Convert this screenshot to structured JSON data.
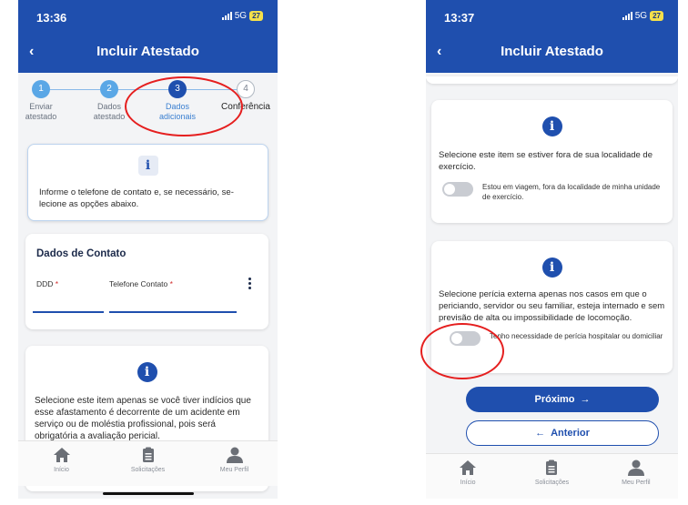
{
  "left": {
    "status": {
      "time": "13:36",
      "network": "5G",
      "battery": "27"
    },
    "header": {
      "back": "‹",
      "title": "Incluir Atestado"
    },
    "steps": [
      {
        "num": "1",
        "label": "Enviar atestado"
      },
      {
        "num": "2",
        "label": "Dados atestado"
      },
      {
        "num": "3",
        "label": "Dados adicionais"
      },
      {
        "num": "4",
        "label": "Conferência"
      }
    ],
    "info_card": {
      "icon": "info-icon",
      "text": "Informe o telefone de contato e, se necessário, se-lecione as opções abaixo."
    },
    "contact_card": {
      "title": "Dados de Contato",
      "ddd_label": "DDD",
      "phone_label": "Telefone Contato",
      "required_mark": "*",
      "menu_icon": "more-vertical-icon"
    },
    "accident_card": {
      "icon": "info-icon",
      "text": "Selecione este item apenas se você tiver indícios que esse afastamento é decorrente de um acidente em serviço ou de moléstia profissional, pois será obrigatória a avaliação pericial."
    },
    "tabbar": [
      {
        "icon": "home-icon",
        "label": "Início"
      },
      {
        "icon": "clipboard-icon",
        "label": "Solicitações"
      },
      {
        "icon": "user-icon",
        "label": "Meu Perfil"
      }
    ]
  },
  "right": {
    "status": {
      "time": "13:37",
      "network": "5G",
      "battery": "27"
    },
    "header": {
      "back": "‹",
      "title": "Incluir Atestado"
    },
    "travel_card": {
      "icon": "info-icon",
      "text": "Selecione este item se estiver fora de sua localidade de exercício.",
      "toggle_label": "Estou em viagem, fora da localidade de minha unidade de exercício."
    },
    "hospital_card": {
      "icon": "info-icon",
      "text": "Selecione perícia externa apenas nos casos em que o periciando, servidor ou seu familiar, esteja internado e sem previsão de alta ou impossibilidade de locomoção.",
      "toggle_label": "Tenho necessidade de perícia hospitalar ou domiciliar"
    },
    "next_button": {
      "label": "Próximo",
      "icon": "arrow-right-icon",
      "glyph": "→"
    },
    "prev_button": {
      "label": "Anterior",
      "icon": "arrow-left-icon",
      "glyph": "←"
    },
    "tabbar": [
      {
        "icon": "home-icon",
        "label": "Início"
      },
      {
        "icon": "clipboard-icon",
        "label": "Solicitações"
      },
      {
        "icon": "user-icon",
        "label": "Meu Perfil"
      }
    ]
  },
  "colors": {
    "primary": "#1f4fae",
    "step_done": "#5aa7e6",
    "highlight": "#e51f1f"
  }
}
